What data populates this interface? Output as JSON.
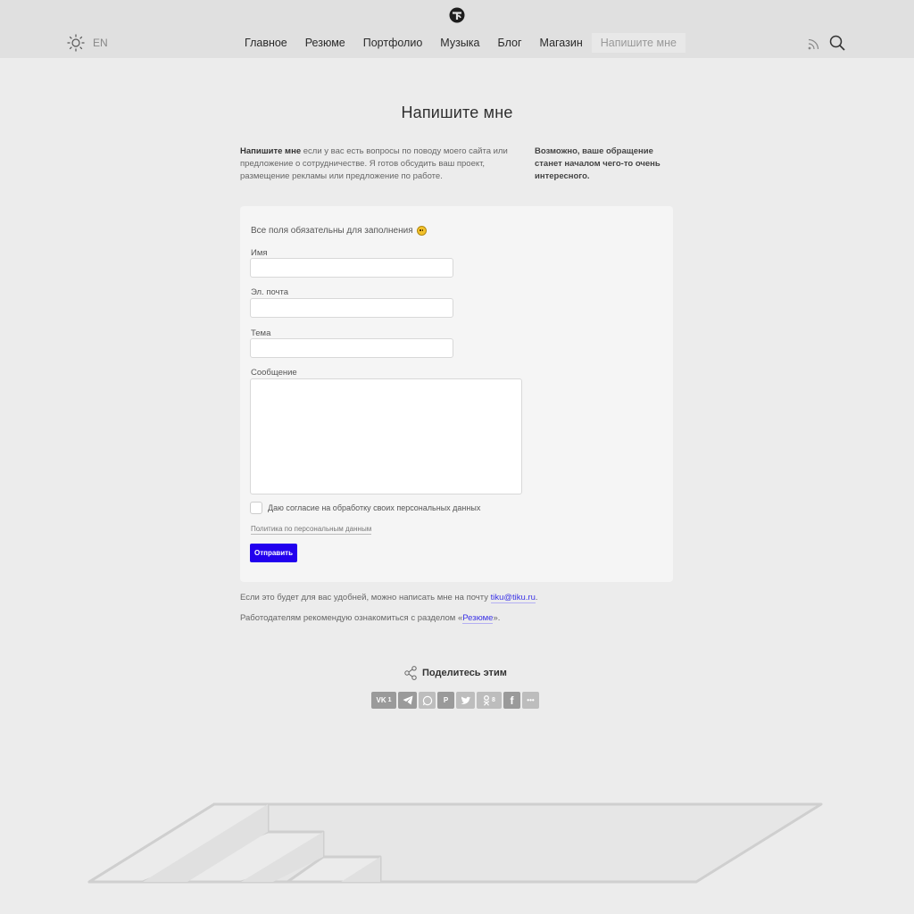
{
  "header": {
    "lang": "EN",
    "nav": [
      {
        "label": "Главное",
        "active": false
      },
      {
        "label": "Резюме",
        "active": false
      },
      {
        "label": "Портфолио",
        "active": false
      },
      {
        "label": "Музыка",
        "active": false
      },
      {
        "label": "Блог",
        "active": false
      },
      {
        "label": "Магазин",
        "active": false
      },
      {
        "label": "Напишите мне",
        "active": true
      }
    ]
  },
  "page": {
    "title": "Напишите мне",
    "intro_bold": "Напишите мне",
    "intro_text": " если у вас есть вопросы по поводу моего сайта или предложение о сотрудничестве. Я готов обсудить ваш проект, размещение рекламы или предложение по работе.",
    "intro_right": "Возможно, ваше обращение станет началом чего-то очень интересного."
  },
  "form": {
    "notice": "Все поля обязательны для заполнения",
    "name_label": "Имя",
    "name_value": "",
    "email_label": "Эл. почта",
    "email_value": "",
    "subject_label": "Тема",
    "subject_value": "",
    "message_label": "Сообщение",
    "message_value": "",
    "consent_label": "Даю согласие на обработку своих персональных данных",
    "consent_checked": false,
    "policy_link": "Политика по персональным данным",
    "submit_label": "Отправить"
  },
  "notes": {
    "email_prefix": "Если это будет для вас удобней, можно написать мне на почту ",
    "email": "tiku@tiku.ru",
    "email_suffix": ".",
    "resume_prefix": "Работодателям рекомендую ознакомиться с разделом «",
    "resume_link": "Резюме",
    "resume_suffix": "»."
  },
  "share": {
    "label": "Поделитесь этим",
    "buttons": [
      {
        "icon": "vk-icon",
        "text": "VK",
        "count": "1"
      },
      {
        "icon": "telegram-icon",
        "text": "",
        "count": ""
      },
      {
        "icon": "whatsapp-icon",
        "text": "",
        "count": ""
      },
      {
        "icon": "pinterest-icon",
        "text": "P",
        "count": ""
      },
      {
        "icon": "twitter-icon",
        "text": "",
        "count": ""
      },
      {
        "icon": "odnoklassniki-icon",
        "text": "",
        "count": "8"
      },
      {
        "icon": "facebook-icon",
        "text": "f",
        "count": ""
      },
      {
        "icon": "more-icon",
        "text": "•••",
        "count": ""
      }
    ]
  },
  "colors": {
    "accent": "#2200ee",
    "background": "#ececec",
    "header": "#e0e0e0",
    "card": "#f5f5f5"
  }
}
